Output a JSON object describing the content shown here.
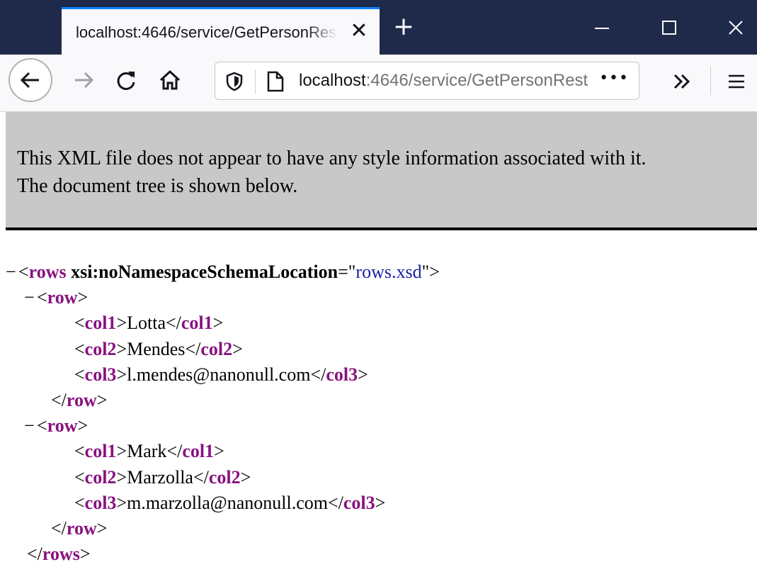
{
  "tab": {
    "title": "localhost:4646/service/GetPersonRest"
  },
  "urlbar": {
    "host": "localhost",
    "rest": ":4646/service/GetPersonRest",
    "dots": "•••"
  },
  "info": {
    "line1": "This XML file does not appear to have any style information associated with it.",
    "line2": "The document tree is shown below."
  },
  "xml": {
    "root_tag": "rows",
    "root_attr_name": "xsi:noNamespaceSchemaLocation",
    "root_attr_value": "rows.xsd",
    "row_tag": "row",
    "rows": [
      {
        "col1": "Lotta",
        "col2": "Mendes",
        "col3": "l.mendes@nanonull.com"
      },
      {
        "col1": "Mark",
        "col2": "Marzolla",
        "col3": "m.marzolla@nanonull.com"
      }
    ],
    "col_tags": [
      "col1",
      "col2",
      "col3"
    ],
    "fold_glyph": "−"
  },
  "colors": {
    "tab_accent": "#0a84ff",
    "titlebar": "#1f2a4a",
    "tag": "#881280",
    "attr_value": "#1a1aa6",
    "info_bg": "#c8c8c8"
  }
}
